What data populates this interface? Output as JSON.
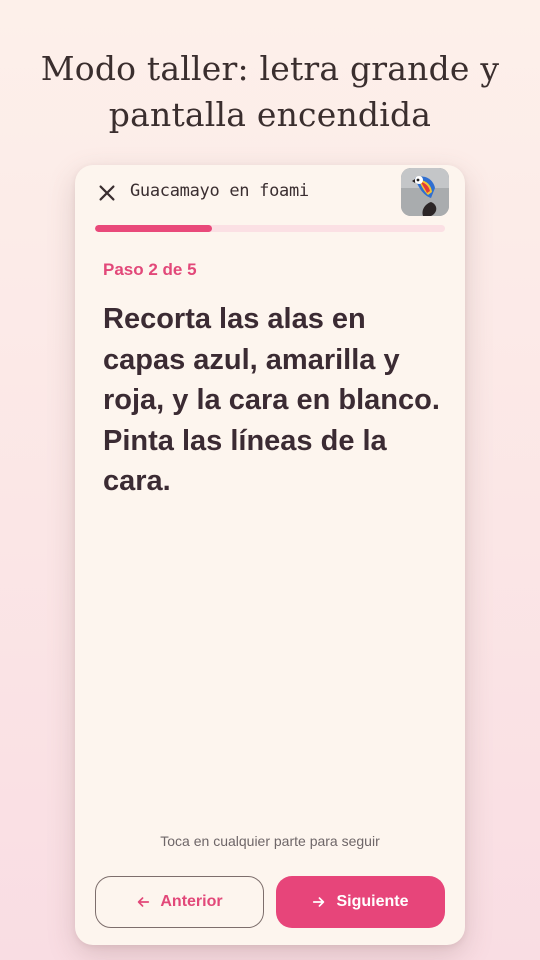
{
  "headline": {
    "line1": "Modo taller: letra grande y",
    "line2": "pantalla encendida"
  },
  "card": {
    "title": "Guacamayo en foami",
    "progress_fraction": 0.333,
    "step_label": "Paso 2 de 5",
    "instruction": "Recorta las alas en capas azul, amarilla y roja, y la cara en blanco. Pinta las líneas de la cara.",
    "hint": "Toca en cualquier parte para seguir",
    "prev_label": "Anterior",
    "next_label": "Siguiente"
  },
  "icons": {
    "close": "close-icon",
    "prev": "arrow-left-icon",
    "next": "arrow-right-icon"
  },
  "colors": {
    "accent": "#e7457a",
    "progress_track": "#fbe0e4",
    "card_background": "#fdf5ee"
  }
}
